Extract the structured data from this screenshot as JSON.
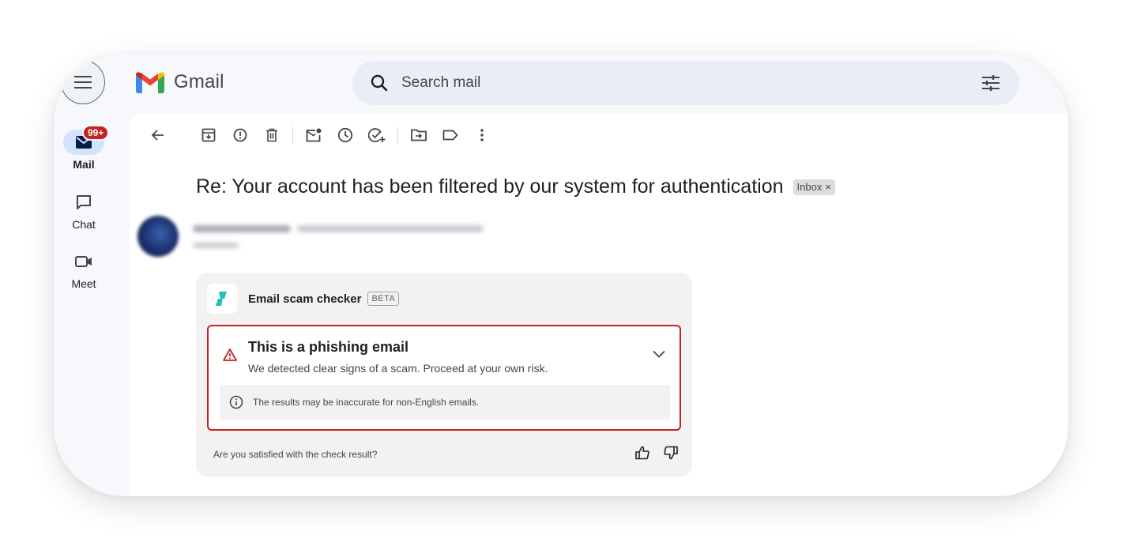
{
  "app": {
    "name": "Gmail"
  },
  "nav": {
    "menu_icon": "hamburger-menu-icon",
    "items": [
      {
        "label": "Mail",
        "icon": "mail-icon",
        "badge": "99+",
        "active": true
      },
      {
        "label": "Chat",
        "icon": "chat-icon",
        "active": false
      },
      {
        "label": "Meet",
        "icon": "video-camera-icon",
        "active": false
      }
    ]
  },
  "search": {
    "placeholder": "Search mail",
    "value": ""
  },
  "toolbar": {
    "buttons": [
      "back-arrow-icon",
      "archive-icon",
      "report-spam-icon",
      "delete-icon",
      "mark-unread-icon",
      "snooze-icon",
      "add-to-tasks-icon",
      "move-to-icon",
      "label-icon",
      "more-vert-icon"
    ]
  },
  "email": {
    "subject": "Re: Your account has been filtered by our system for authentication",
    "label_chip": "Inbox",
    "label_chip_remove": "×"
  },
  "scam_checker": {
    "title": "Email scam checker",
    "beta": "BETA",
    "verdict_title": "This is a phishing email",
    "verdict_desc": "We detected clear signs of a scam. Proceed at your own risk.",
    "info": "The results may be inaccurate for non-English emails.",
    "feedback_question": "Are you satisfied with the check result?"
  },
  "colors": {
    "accent_blue": "#d3e3fd",
    "danger": "#c5221f",
    "badge": "#c5221f",
    "surfshark_teal": "#1ebfbf",
    "search_bg": "#e9eef6"
  }
}
